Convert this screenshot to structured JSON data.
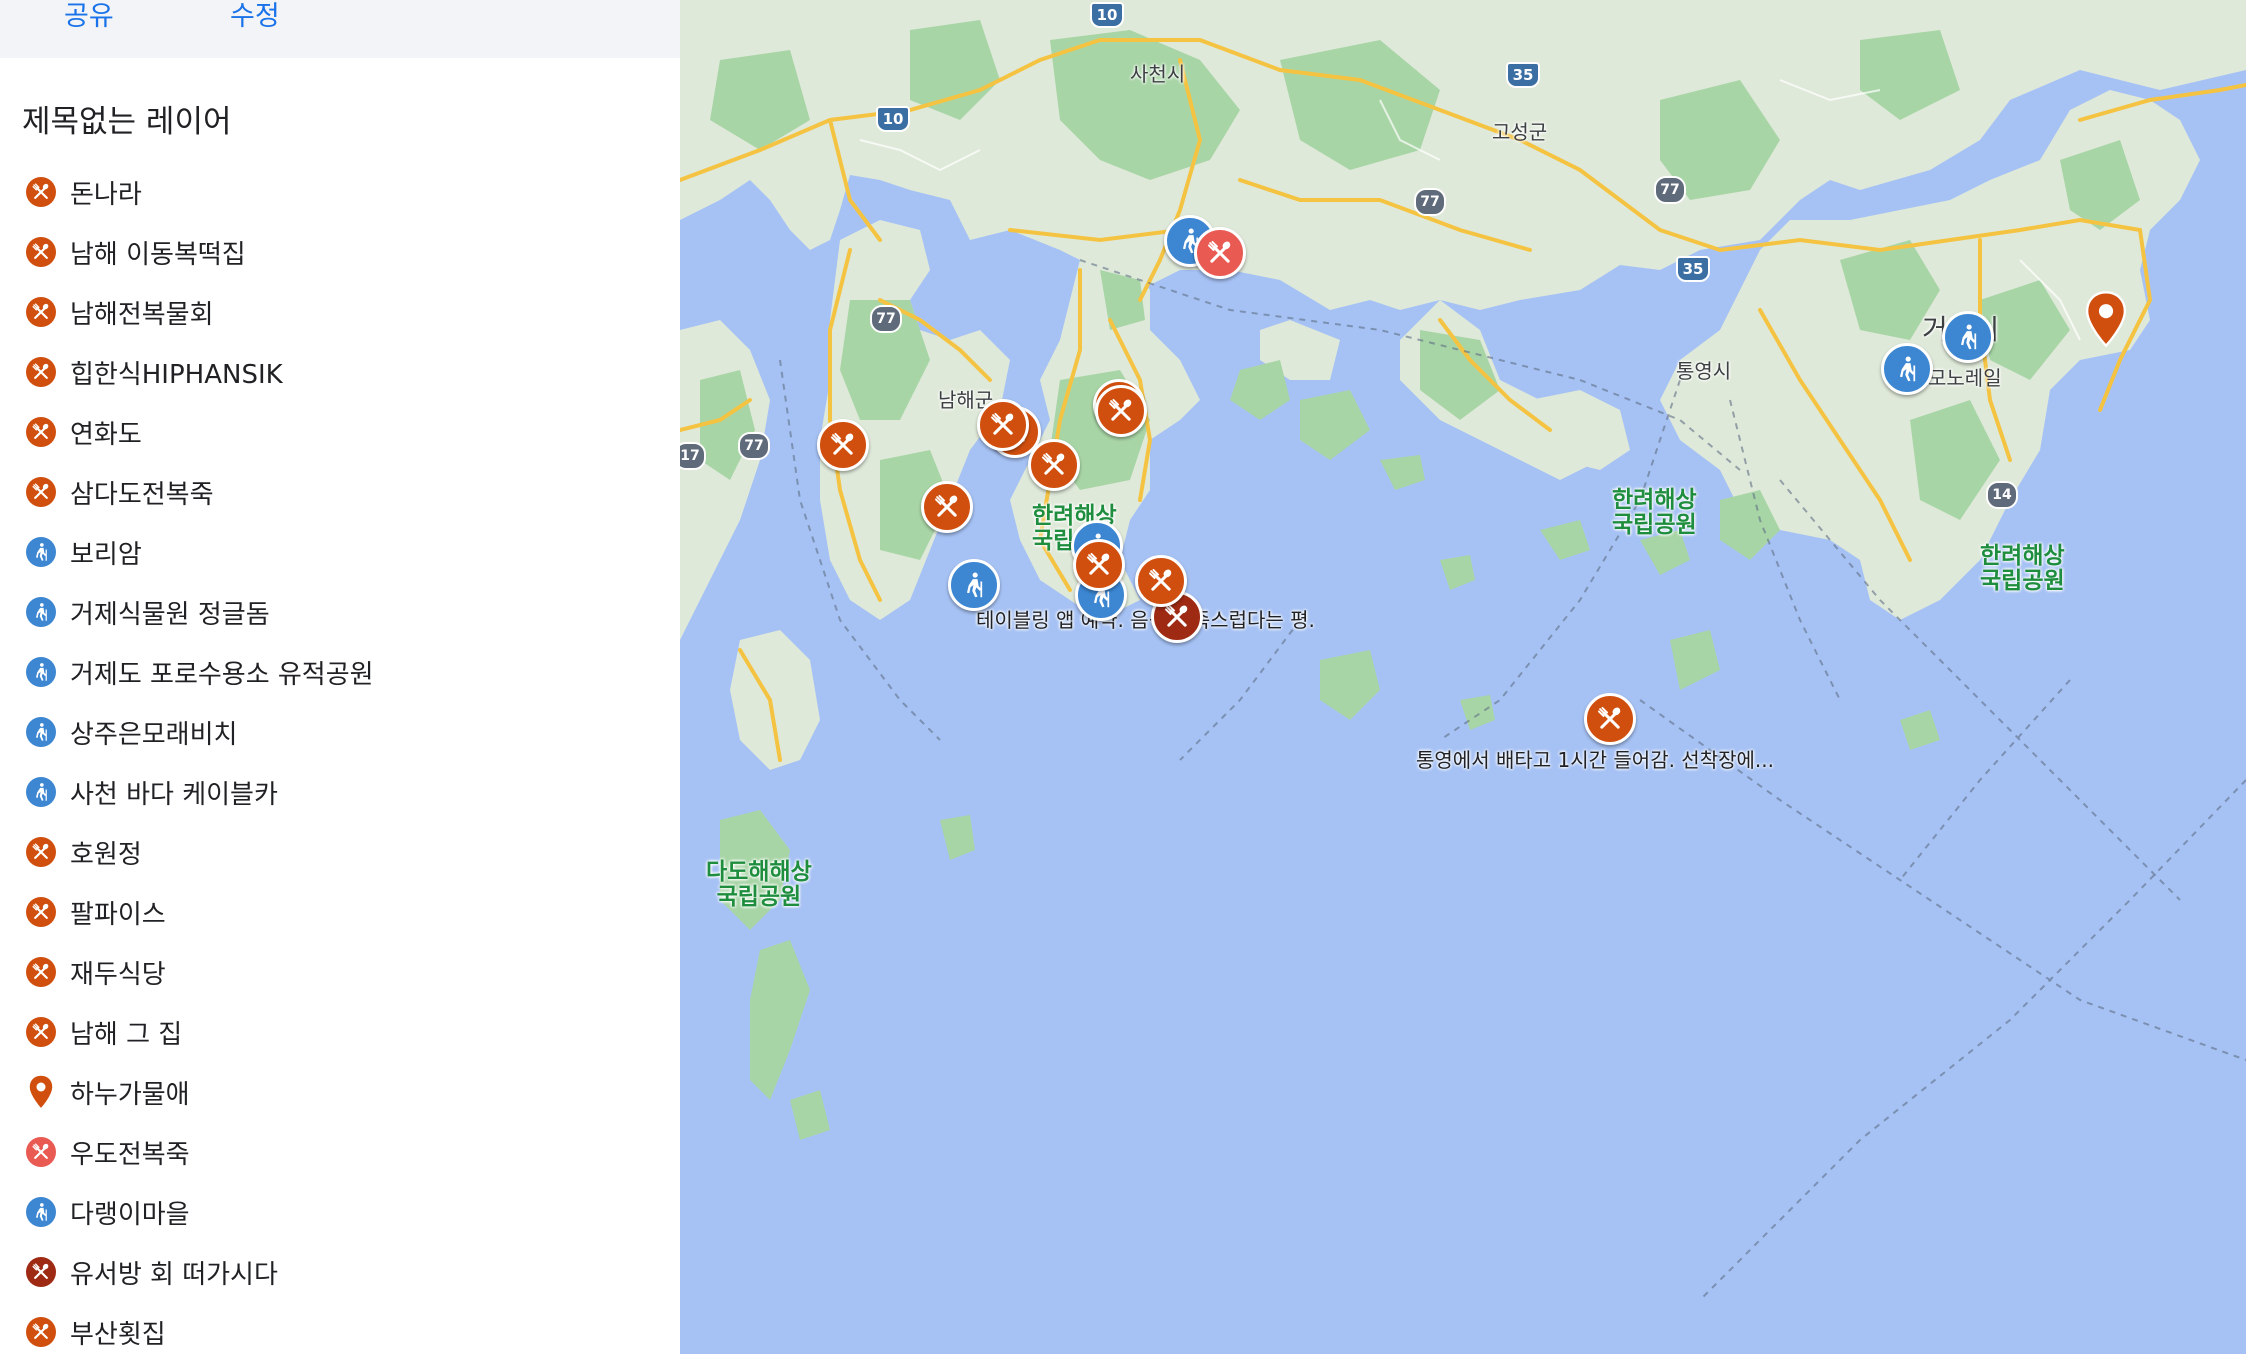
{
  "sidebar": {
    "share_label": "공유",
    "edit_label": "수정",
    "layer_title": "제목없는 레이어",
    "items": [
      {
        "label": "돈나라",
        "icon": "restaurant-icon",
        "color": "#d14f0e"
      },
      {
        "label": "남해 이동복떡집",
        "icon": "restaurant-icon",
        "color": "#d14f0e"
      },
      {
        "label": "남해전복물회",
        "icon": "restaurant-icon",
        "color": "#d14f0e"
      },
      {
        "label": "힙한식HIPHANSIK",
        "icon": "restaurant-icon",
        "color": "#d14f0e"
      },
      {
        "label": "연화도",
        "icon": "restaurant-icon",
        "color": "#d14f0e"
      },
      {
        "label": "삼다도전복죽",
        "icon": "restaurant-icon",
        "color": "#d14f0e"
      },
      {
        "label": "보리암",
        "icon": "hiking-icon",
        "color": "#3c86d2"
      },
      {
        "label": "거제식물원 정글돔",
        "icon": "hiking-icon",
        "color": "#3c86d2"
      },
      {
        "label": "거제도 포로수용소 유적공원",
        "icon": "hiking-icon",
        "color": "#3c86d2"
      },
      {
        "label": "상주은모래비치",
        "icon": "hiking-icon",
        "color": "#3c86d2"
      },
      {
        "label": "사천 바다 케이블카",
        "icon": "hiking-icon",
        "color": "#3c86d2"
      },
      {
        "label": "호원정",
        "icon": "restaurant-icon",
        "color": "#d14f0e"
      },
      {
        "label": "팔파이스",
        "icon": "restaurant-icon",
        "color": "#d14f0e"
      },
      {
        "label": "재두식당",
        "icon": "restaurant-icon",
        "color": "#d14f0e"
      },
      {
        "label": "남해 그 집",
        "icon": "restaurant-icon",
        "color": "#d14f0e"
      },
      {
        "label": "하누가물애",
        "icon": "pin-icon",
        "color": "#d14f0e"
      },
      {
        "label": "우도전복죽",
        "icon": "restaurant-icon",
        "color": "#e95a53"
      },
      {
        "label": "다랭이마을",
        "icon": "hiking-icon",
        "color": "#3c86d2"
      },
      {
        "label": "유서방 회 떠가시다",
        "icon": "restaurant-icon",
        "color": "#9f2a14"
      },
      {
        "label": "부산횟집",
        "icon": "restaurant-icon",
        "color": "#d14f0e"
      }
    ]
  },
  "map": {
    "colors": {
      "water": "#a6c2f4",
      "land": "#dfe9d9",
      "forest": "#a8d5a6",
      "road": "#f5c342"
    },
    "place_labels": [
      {
        "text": "사천시",
        "kind": "city"
      },
      {
        "text": "고성군",
        "kind": "city"
      },
      {
        "text": "남해군",
        "kind": "city"
      },
      {
        "text": "통영시",
        "kind": "city"
      },
      {
        "text": "거제시",
        "kind": "city"
      },
      {
        "text": "모노레일",
        "kind": "poi"
      },
      {
        "text": "한려해상\n국립공원",
        "kind": "park"
      },
      {
        "text": "한려해상\n국립공원",
        "kind": "park"
      },
      {
        "text": "한려해상\n국립공원",
        "kind": "park"
      },
      {
        "text": "다도해해상\n국립공원",
        "kind": "park"
      }
    ],
    "notes": [
      "테이블링 앱 예약. 음식 만족스럽다는 평.",
      "통영에서 배타고 1시간 들어감. 선착장에..."
    ],
    "road_shields": [
      "10",
      "10",
      "35",
      "35",
      "77",
      "77",
      "77",
      "77",
      "14",
      "17"
    ],
    "markers": [
      {
        "type": "hiking",
        "color": "#3c86d2"
      },
      {
        "type": "restaurant",
        "color": "#e95a53"
      },
      {
        "type": "restaurant",
        "color": "#d14f0e"
      },
      {
        "type": "restaurant",
        "color": "#d14f0e"
      },
      {
        "type": "restaurant",
        "color": "#d14f0e"
      },
      {
        "type": "restaurant",
        "color": "#d14f0e"
      },
      {
        "type": "restaurant",
        "color": "#d14f0e"
      },
      {
        "type": "restaurant",
        "color": "#d14f0e"
      },
      {
        "type": "hiking",
        "color": "#3c86d2"
      },
      {
        "type": "hiking",
        "color": "#3c86d2"
      },
      {
        "type": "restaurant",
        "color": "#d14f0e"
      },
      {
        "type": "hiking",
        "color": "#3c86d2"
      },
      {
        "type": "restaurant",
        "color": "#d14f0e"
      },
      {
        "type": "restaurant",
        "color": "#9f2a14"
      },
      {
        "type": "restaurant",
        "color": "#d14f0e"
      },
      {
        "type": "hiking",
        "color": "#3c86d2"
      },
      {
        "type": "hiking",
        "color": "#3c86d2"
      },
      {
        "type": "pin",
        "color": "#d14f0e"
      }
    ]
  }
}
